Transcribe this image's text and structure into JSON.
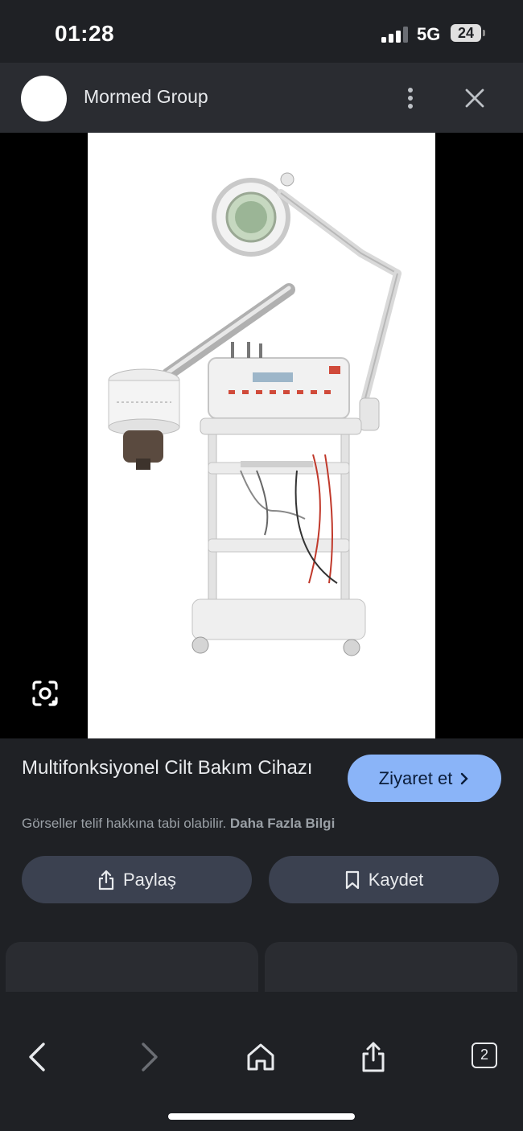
{
  "status": {
    "time": "01:28",
    "network": "5G",
    "battery": "24"
  },
  "header": {
    "site_name": "Mormed Group"
  },
  "result": {
    "title": "Multifonksiyonel Cilt Bakım Cihazı",
    "visit_label": "Ziyaret et",
    "copyright_text": "Görseller telif hakkına tabi olabilir.",
    "more_info_link": "Daha Fazla Bilgi"
  },
  "actions": {
    "share_label": "Paylaş",
    "save_label": "Kaydet"
  },
  "nav": {
    "tab_count": "2"
  },
  "colors": {
    "accent": "#8ab4f8",
    "background": "#1f2125",
    "pill": "#3b4150"
  },
  "icons": [
    "signal-icon",
    "battery-icon",
    "more-vert-icon",
    "close-icon",
    "lens-icon",
    "share-icon",
    "bookmark-icon",
    "back-icon",
    "forward-icon",
    "home-icon",
    "share-nav-icon",
    "tabs-icon"
  ]
}
